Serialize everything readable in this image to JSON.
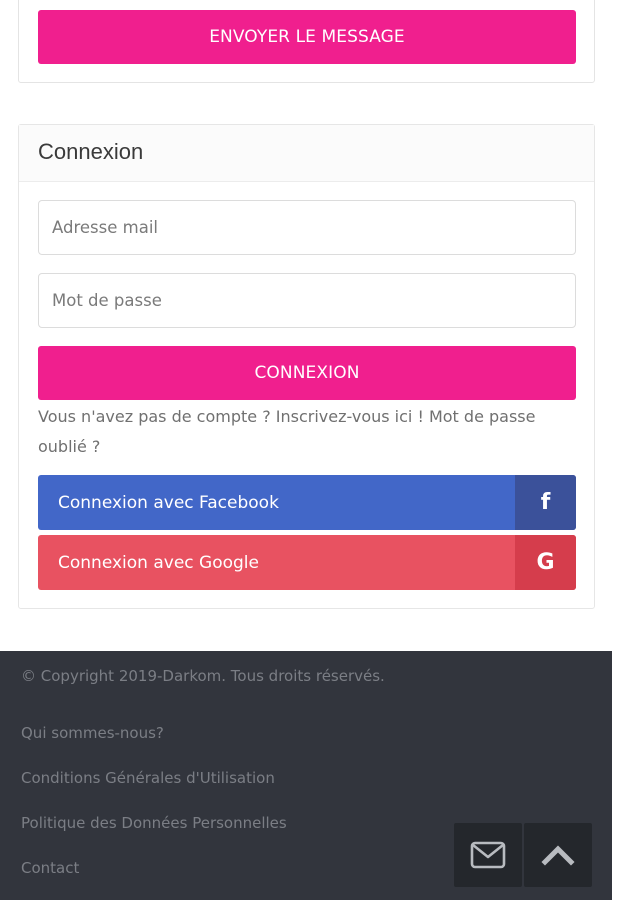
{
  "contact_form": {
    "send_label": "ENVOYER LE MESSAGE"
  },
  "login": {
    "title": "Connexion",
    "email_placeholder": "Adresse mail",
    "password_placeholder": "Mot de passe",
    "submit_label": "CONNEXION",
    "help_prefix": "Vous n'avez pas de compte ? ",
    "register_link": "Inscrivez-vous ici !",
    "forgot_link": "Mot de passe oublié ?",
    "facebook_label": "Connexion avec Facebook",
    "facebook_icon_glyph": "f",
    "google_label": "Connexion avec Google",
    "google_icon_glyph": "G"
  },
  "footer": {
    "copyright": "© Copyright 2019-Darkom. Tous droits réservés.",
    "links": [
      "Qui sommes-nous?",
      "Conditions Générales d'Utilisation",
      "Politique des Données Personnelles",
      "Contact"
    ],
    "mail_icon": "envelope-icon",
    "top_icon": "chevron-up-icon"
  },
  "colors": {
    "accent_pink": "#f01f8e",
    "facebook": "#4267c8",
    "google": "#e85261",
    "footer_bg": "#32353d"
  }
}
